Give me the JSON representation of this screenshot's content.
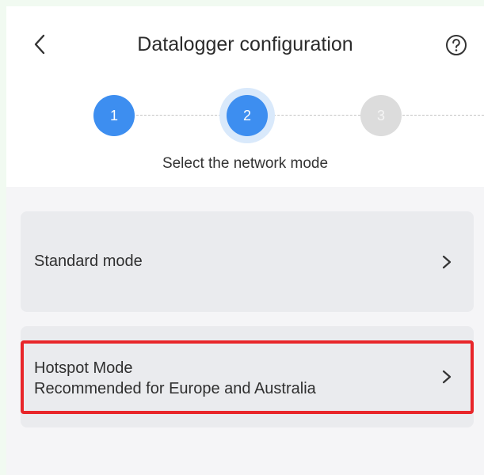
{
  "header": {
    "title": "Datalogger configuration",
    "back_icon": "chevron-left-icon",
    "help_icon": "help-circle-icon"
  },
  "stepper": {
    "steps": [
      {
        "label": "1",
        "state": "completed"
      },
      {
        "label": "2",
        "state": "current"
      },
      {
        "label": "3",
        "state": "pending"
      }
    ],
    "subtitle": "Select the network mode"
  },
  "options": [
    {
      "title": "Standard mode",
      "description": ""
    },
    {
      "title": "Hotspot Mode",
      "description": "Recommended for Europe and Australia",
      "highlighted": true
    }
  ],
  "colors": {
    "accent": "#3d8ef0",
    "accent_halo": "#d9e9fb",
    "pending_step": "#dcdcdc",
    "card_bg": "#eaebee",
    "highlight": "#e8262a"
  }
}
